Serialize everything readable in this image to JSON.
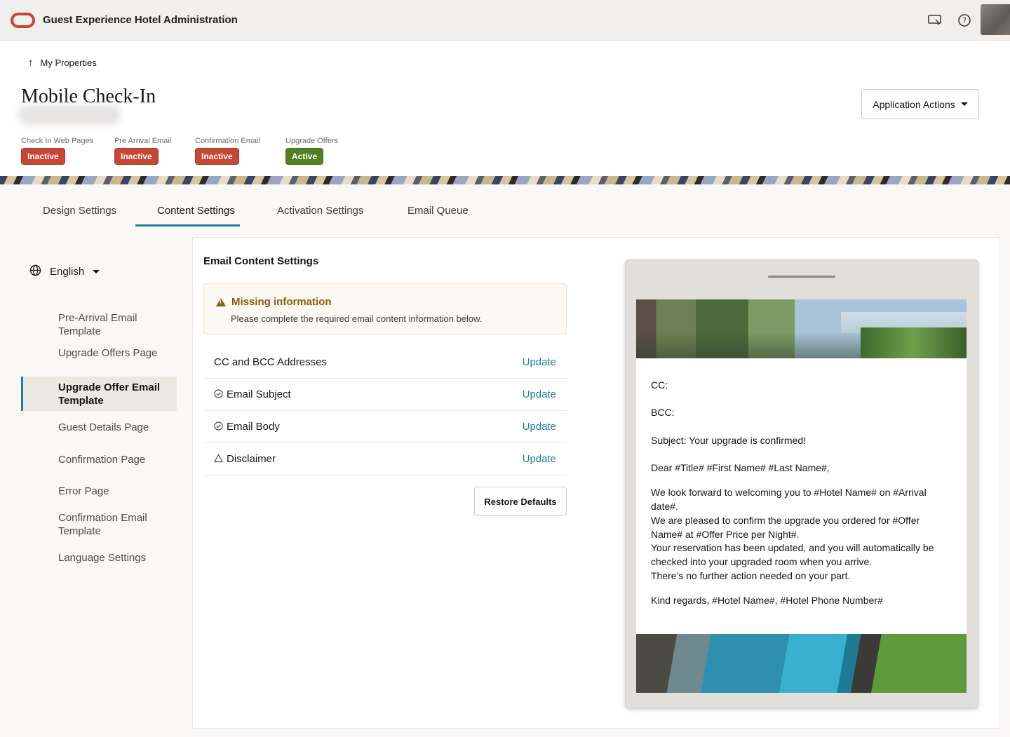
{
  "header": {
    "app_title": "Guest Experience Hotel Administration",
    "icons": [
      "present-screen-icon",
      "help-icon",
      "avatar"
    ]
  },
  "page": {
    "back_link": "My Properties",
    "title": "Mobile Check-In",
    "application_actions": "Application Actions"
  },
  "statuses": [
    {
      "label": "Check In Web Pages",
      "state": "Inactive"
    },
    {
      "label": "Pre Arrival Email",
      "state": "Inactive"
    },
    {
      "label": "Confirmation Email",
      "state": "Inactive"
    },
    {
      "label": "Upgrade Offers",
      "state": "Active"
    }
  ],
  "colors": {
    "inactive": "#c74634",
    "active": "#508223",
    "accent": "#227e9e",
    "warning": "#8c5b12"
  },
  "tabs": [
    {
      "label": "Design Settings"
    },
    {
      "label": "Content Settings",
      "active": true
    },
    {
      "label": "Activation Settings"
    },
    {
      "label": "Email Queue"
    }
  ],
  "sidebar": {
    "language": "English",
    "items": [
      {
        "label": "Pre-Arrival Email Template"
      },
      {
        "label": "Upgrade Offers Page"
      },
      {
        "label": "Upgrade Offer Email Template",
        "selected": true
      },
      {
        "label": "Guest Details Page"
      },
      {
        "label": "Confirmation Page"
      },
      {
        "label": "Error Page"
      },
      {
        "label": "Confirmation Email Template"
      },
      {
        "label": "Language Settings"
      }
    ]
  },
  "content": {
    "title": "Email Content Settings",
    "warning_title": "Missing information",
    "warning_text": "Please complete the required email content information below.",
    "rows": [
      {
        "label": "CC and BCC Addresses",
        "icon": "",
        "link": "Update"
      },
      {
        "label": "Email Subject",
        "icon": "check-circle-icon",
        "link": "Update"
      },
      {
        "label": "Email Body",
        "icon": "check-circle-icon",
        "link": "Update"
      },
      {
        "label": "Disclaimer",
        "icon": "warning-outline-icon",
        "link": "Update"
      }
    ],
    "restore_button": "Restore Defaults"
  },
  "preview": {
    "cc": "CC:",
    "bcc": "BCC:",
    "subject": "Subject: Your upgrade is confirmed!",
    "greeting": "Dear #Title# #First Name# #Last Name#,",
    "body_1": "We look forward to welcoming you to #Hotel Name# on #Arrival date#.",
    "body_2": "We are pleased to confirm the upgrade you ordered for #Offer Name# at #Offer Price per Night#.",
    "body_3": "Your reservation has been updated, and you will automatically be checked into your upgraded room when you arrive.",
    "body_4": "There's no further action needed on your part.",
    "signoff": "Kind regards, #Hotel Name#, #Hotel Phone Number#"
  }
}
